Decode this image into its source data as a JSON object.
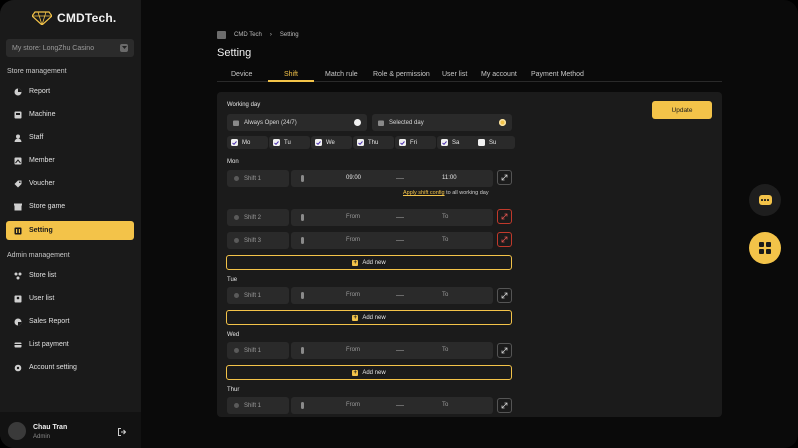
{
  "brand": {
    "name": "CMDTech.",
    "accent": "#f3c349"
  },
  "store": {
    "label": "My store: LongZhu Casino"
  },
  "sidebar": {
    "store_section": "Store management",
    "store_items": [
      {
        "label": "Report",
        "icon": "pie-chart-icon"
      },
      {
        "label": "Machine",
        "icon": "machine-icon"
      },
      {
        "label": "Staff",
        "icon": "staff-icon"
      },
      {
        "label": "Member",
        "icon": "member-icon"
      },
      {
        "label": "Voucher",
        "icon": "voucher-icon"
      },
      {
        "label": "Store game",
        "icon": "store-icon"
      },
      {
        "label": "Setting",
        "icon": "setting-icon",
        "active": true
      }
    ],
    "admin_section": "Admin management",
    "admin_items": [
      {
        "label": "Store list",
        "icon": "store-list-icon"
      },
      {
        "label": "User list",
        "icon": "user-list-icon"
      },
      {
        "label": "Sales Report",
        "icon": "sales-report-icon"
      },
      {
        "label": "List payment",
        "icon": "payment-icon"
      },
      {
        "label": "Account setting",
        "icon": "gear-icon"
      }
    ]
  },
  "user": {
    "name": "Chau Tran",
    "role": "Admin"
  },
  "breadcrumb": {
    "root": "CMD Tech",
    "current": "Setting"
  },
  "page": {
    "title": "Setting"
  },
  "tabs": [
    "Device",
    "Shift",
    "Match rule",
    "Role & permission",
    "User list",
    "My account",
    "Payment Method"
  ],
  "active_tab": "Shift",
  "form": {
    "update_label": "Update",
    "working_day_label": "Working day",
    "mode_always": "Always Open (24/7)",
    "mode_selected": "Selected day",
    "selected_mode": "Selected day",
    "days": [
      {
        "label": "Mo",
        "checked": true
      },
      {
        "label": "Tu",
        "checked": true
      },
      {
        "label": "We",
        "checked": true
      },
      {
        "label": "Thu",
        "checked": true
      },
      {
        "label": "Fri",
        "checked": true
      },
      {
        "label": "Sa",
        "checked": true
      },
      {
        "label": "Su",
        "checked": false
      }
    ],
    "apply_text": "Apply shift config",
    "apply_suffix": " to all working day",
    "add_new": "Add new",
    "from": "From",
    "to": "To",
    "groups": [
      {
        "day": "Mon",
        "shifts": [
          {
            "name": "Shift 1",
            "from": "09:00",
            "to": "11:00"
          },
          {
            "name": "Shift 2",
            "from": "From",
            "to": "To"
          },
          {
            "name": "Shift 3",
            "from": "From",
            "to": "To"
          }
        ]
      },
      {
        "day": "Tue",
        "shifts": [
          {
            "name": "Shift 1",
            "from": "From",
            "to": "To"
          }
        ]
      },
      {
        "day": "Wed",
        "shifts": [
          {
            "name": "Shift 1",
            "from": "From",
            "to": "To"
          }
        ]
      },
      {
        "day": "Thur",
        "shifts": [
          {
            "name": "Shift 1",
            "from": "From",
            "to": "To"
          }
        ]
      }
    ]
  }
}
